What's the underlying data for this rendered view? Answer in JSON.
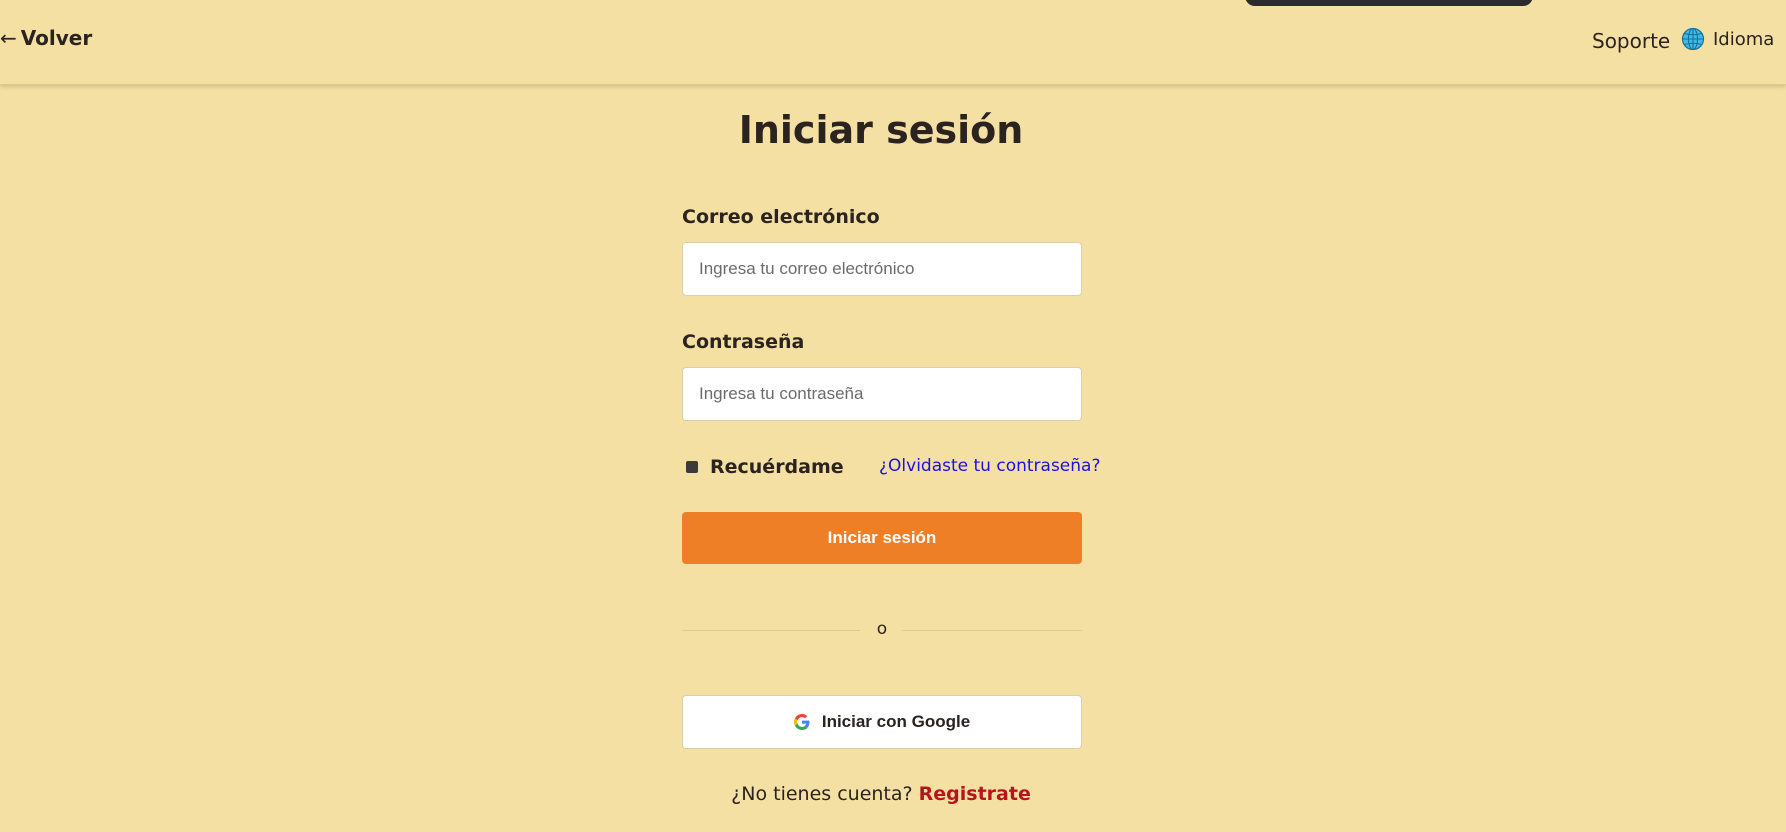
{
  "header": {
    "back_label": "Volver",
    "back_arrow": "←",
    "support_label": "Soporte",
    "language_label": "Idioma",
    "language_icon": "globe-icon"
  },
  "login": {
    "title": "Iniciar sesión",
    "email": {
      "label": "Correo electrónico",
      "value": "",
      "placeholder": "Ingresa tu correo electrónico"
    },
    "password": {
      "label": "Contraseña",
      "value": "",
      "placeholder": "Ingresa tu contraseña"
    },
    "remember_label": "Recuérdame",
    "forgot_label": "¿Olvidaste tu contraseña?",
    "submit_label": "Iniciar sesión",
    "divider_text": "o",
    "google_label": "Iniciar con Google",
    "google_icon": "google-icon",
    "signup_prompt": "¿No tienes cuenta?",
    "signup_link": "Registrate"
  },
  "colors": {
    "background": "#f5e0a3",
    "primary_button": "#ee7f26",
    "link_blue": "#1a10e8",
    "signup_red": "#b5161e",
    "text": "#2a2320"
  }
}
